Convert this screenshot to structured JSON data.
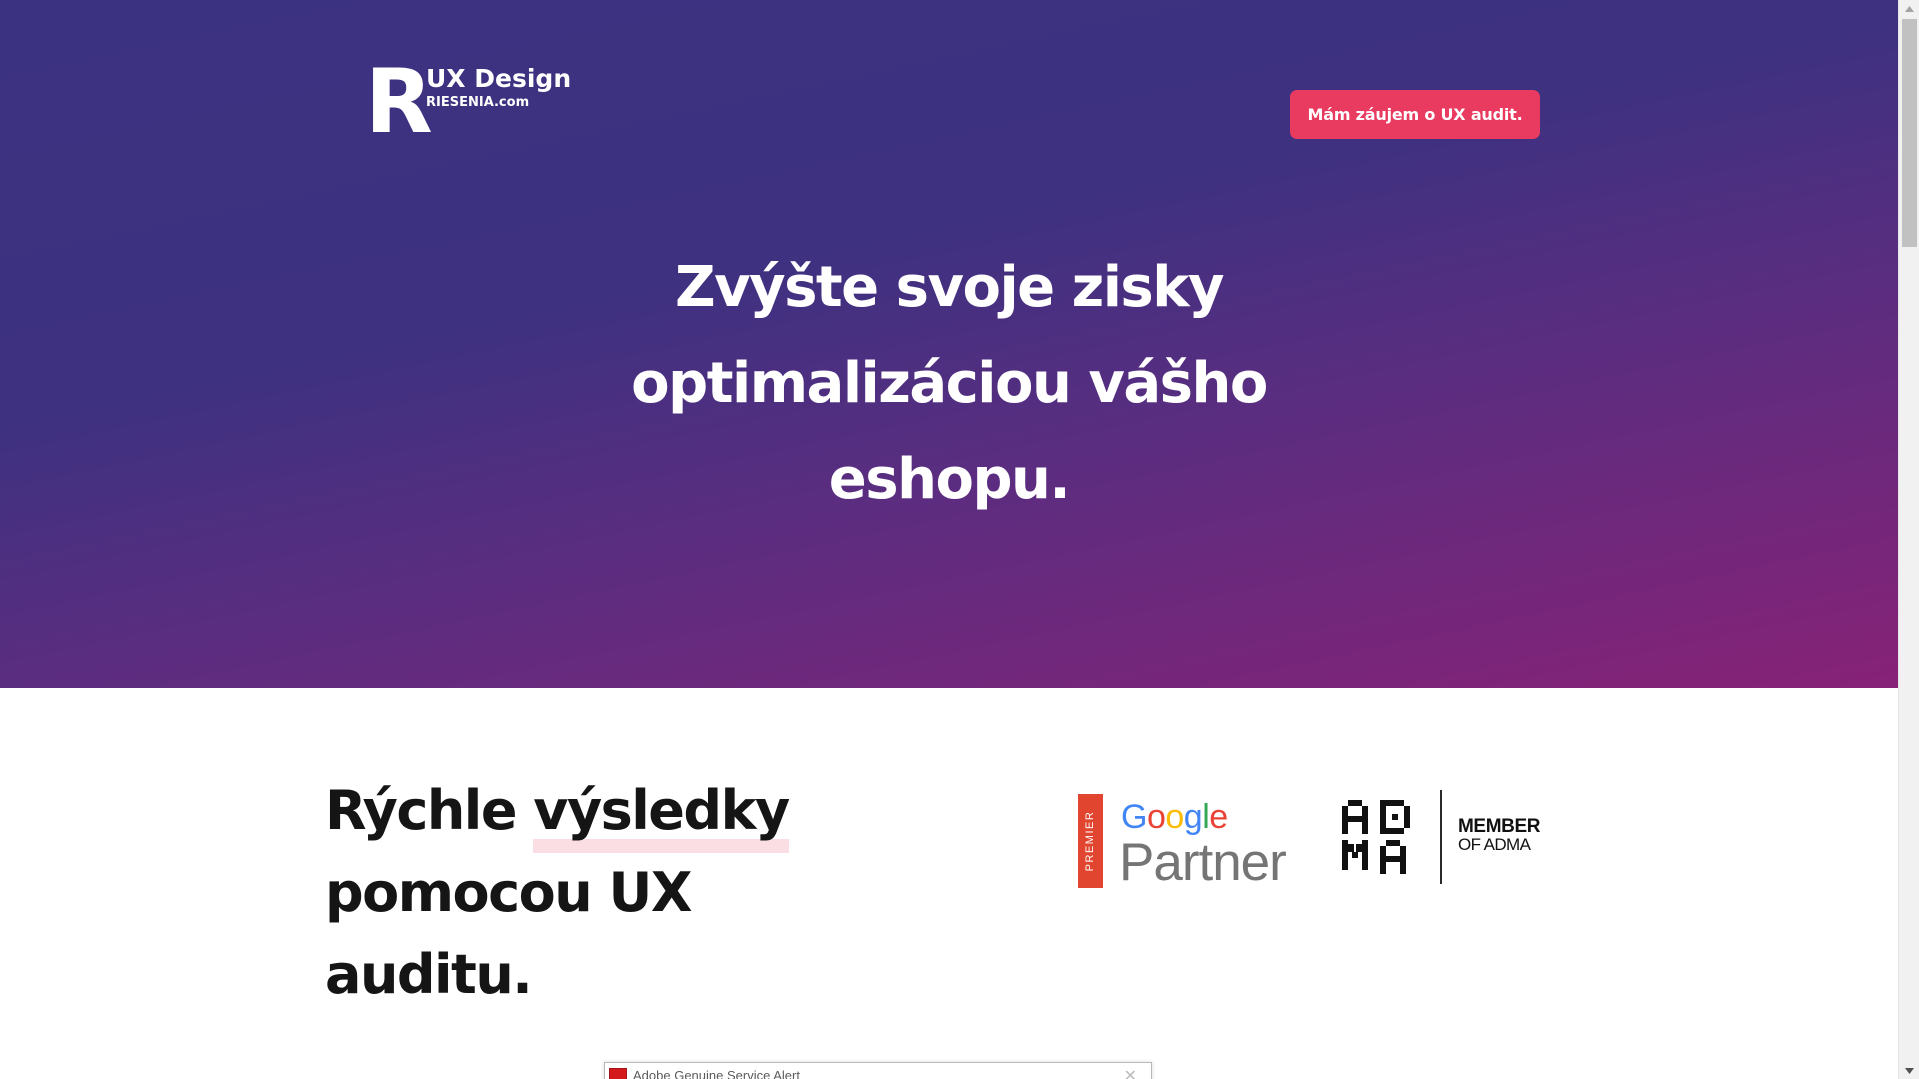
{
  "header": {
    "logo_letter": "R",
    "logo_title": "UX Design",
    "logo_subtitle": "RIESENIA.com",
    "cta_label": "Mám záujem o UX audit."
  },
  "hero": {
    "title_lines": [
      "Zvýšte svoje zisky",
      "optimalizáciou vášho",
      "eshopu."
    ]
  },
  "section": {
    "title_prefix": "Rýchle ",
    "title_highlight": "výsledky",
    "title_line2": "pomocou UX",
    "title_line3": "auditu."
  },
  "badges": {
    "google_premier": "PREMIER",
    "google_word": "Google",
    "google_partner": "Partner",
    "adma_member": "MEMBER",
    "adma_of": "OF ADMA"
  },
  "alert": {
    "title": "Adobe Genuine Service Alert",
    "close_icon": "close-icon"
  },
  "colors": {
    "hero_gradient_start": "#3b3281",
    "hero_gradient_end": "#872277",
    "cta_background": "#e93a5f",
    "highlight": "#fbdde4",
    "google_red": "#e2452f"
  }
}
